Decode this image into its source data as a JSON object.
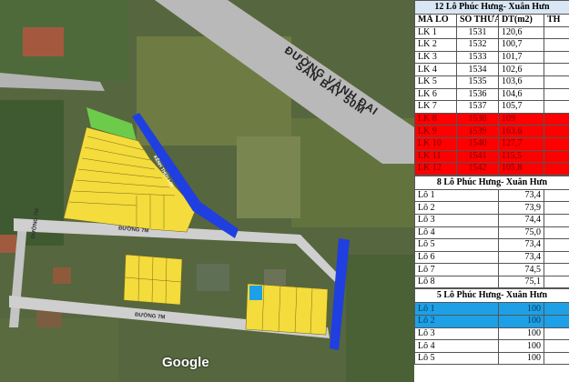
{
  "map": {
    "road_label_1": "ĐƯỜNG VÀNH ĐAI",
    "road_label_2": "SÂN BAY 50M",
    "canal_label": "KÊNH THỦY LỢI",
    "road_7m_1": "ĐƯỜNG 7M",
    "road_7m_2": "ĐƯỜNG 7M",
    "road_7m_3": "ĐƯỜNG 7M",
    "google_label": "Google"
  },
  "table1": {
    "title": "12 Lô Phúc Hưng- Xuân Hưn",
    "headers": [
      "MÃ LÔ",
      "SỐ THỬA",
      "DT(m2)",
      "TH"
    ],
    "rows": [
      {
        "code": "LK 1",
        "parcel": "1531",
        "area": "120,6",
        "status": "normal"
      },
      {
        "code": "LK 2",
        "parcel": "1532",
        "area": "100,7",
        "status": "normal"
      },
      {
        "code": "LK 3",
        "parcel": "1533",
        "area": "101,7",
        "status": "normal"
      },
      {
        "code": "LK 4",
        "parcel": "1534",
        "area": "102,6",
        "status": "normal"
      },
      {
        "code": "LK 5",
        "parcel": "1535",
        "area": "103,6",
        "status": "normal"
      },
      {
        "code": "LK 6",
        "parcel": "1536",
        "area": "104,6",
        "status": "normal"
      },
      {
        "code": "LK 7",
        "parcel": "1537",
        "area": "105,7",
        "status": "normal"
      },
      {
        "code": "LK 8",
        "parcel": "1538",
        "area": "109",
        "status": "sold"
      },
      {
        "code": "LK 9",
        "parcel": "1539",
        "area": "163,6",
        "status": "sold"
      },
      {
        "code": "LK 10",
        "parcel": "1540",
        "area": "127,7",
        "status": "sold"
      },
      {
        "code": "LK 11",
        "parcel": "1541",
        "area": "115,5",
        "status": "sold"
      },
      {
        "code": "LK 12",
        "parcel": "1542",
        "area": "105,8",
        "status": "sold"
      }
    ]
  },
  "table2": {
    "title": "8 Lô Phúc Hưng- Xuân Hưn",
    "rows": [
      {
        "code": "Lô 1",
        "area": "73,4"
      },
      {
        "code": "Lô 2",
        "area": "73,9"
      },
      {
        "code": "Lô 3",
        "area": "74,4"
      },
      {
        "code": "Lô 4",
        "area": "75,0"
      },
      {
        "code": "Lô 5",
        "area": "73,4"
      },
      {
        "code": "Lô 6",
        "area": "73,4"
      },
      {
        "code": "Lô 7",
        "area": "74,5"
      },
      {
        "code": "Lô 8",
        "area": "75,1"
      }
    ]
  },
  "table3": {
    "title": "5 Lô Phúc Hưng- Xuân Hưn",
    "rows": [
      {
        "code": "Lô 1",
        "area": "100",
        "status": "highlight"
      },
      {
        "code": "Lô 2",
        "area": "100",
        "status": "highlight"
      },
      {
        "code": "Lô 3",
        "area": "100",
        "status": "normal"
      },
      {
        "code": "Lô 4",
        "area": "100",
        "status": "normal"
      },
      {
        "code": "Lô 5",
        "area": "100",
        "status": "normal"
      }
    ]
  },
  "colors": {
    "sold": "#ff0000",
    "highlight": "#1ea0e6",
    "plot": "#f3dc3c",
    "canal": "#1f3fe0",
    "road": "#c8c8c8"
  }
}
